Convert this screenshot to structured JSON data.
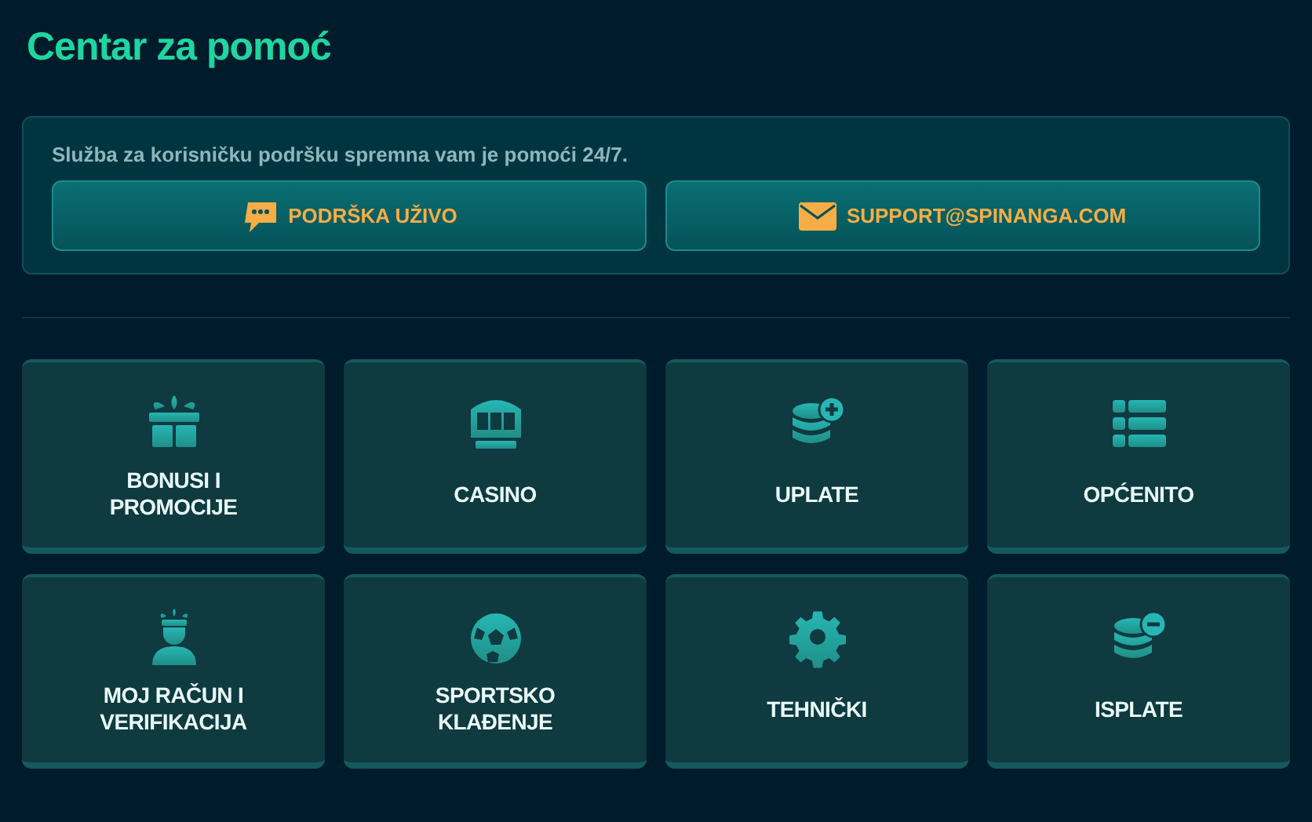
{
  "title": "Centar za pomoć",
  "support": {
    "text": "Služba za korisničku podršku spremna vam je pomoći 24/7.",
    "buttons": [
      {
        "label": "PODRŠKA UŽIVO"
      },
      {
        "label": "SUPPORT@SPINANGA.COM"
      }
    ]
  },
  "categories": [
    {
      "label": "BONUSI I PROMOCIJE"
    },
    {
      "label": "CASINO"
    },
    {
      "label": "UPLATE"
    },
    {
      "label": "OPĆENITO"
    },
    {
      "label": "MOJ RAČUN I VERIFIKACIJA"
    },
    {
      "label": "SPORTSKO KLAĐENJE"
    },
    {
      "label": "TEHNIČKI"
    },
    {
      "label": "ISPLATE"
    }
  ]
}
